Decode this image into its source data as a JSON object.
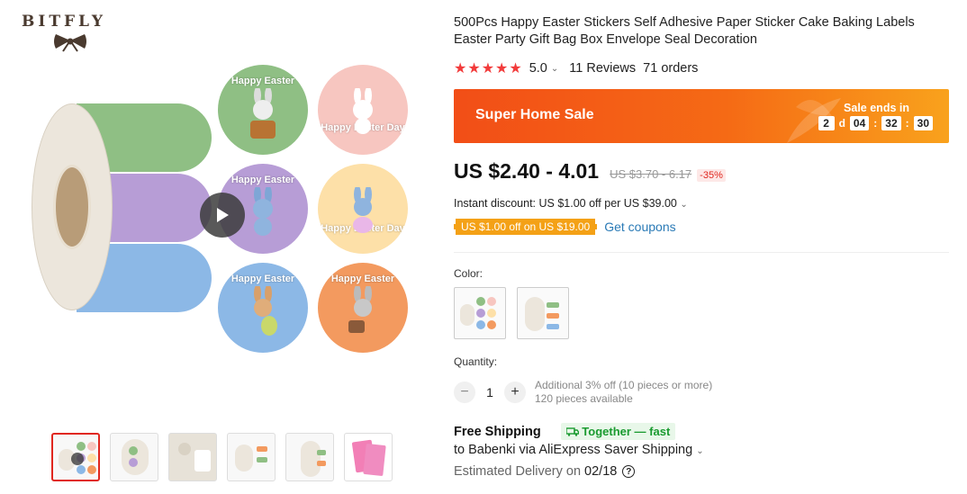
{
  "brand": {
    "name": "BITFLY",
    "logo_icon": "bow-icon"
  },
  "gallery": {
    "stickers": [
      {
        "text": "Happy Easter",
        "color": "#8fbf84"
      },
      {
        "text": "Happy Easter Day",
        "color": "#f7c6c0"
      },
      {
        "text": "Happy Easter",
        "color": "#b79dd6"
      },
      {
        "text": "Happy Easter Day",
        "color": "#fde0a8"
      },
      {
        "text": "Happy Easter",
        "color": "#8cb8e6"
      },
      {
        "text": "Happy Easter",
        "color": "#f39a5f"
      }
    ],
    "play_icon": "play-icon",
    "thumbnail_count": 6,
    "active_thumbnail": 1
  },
  "product": {
    "title": "500Pcs Happy Easter Stickers Self Adhesive Paper Sticker Cake Baking Labels Easter Party Gift Bag Box Envelope Seal Decoration",
    "rating": "5.0",
    "reviews": "11 Reviews",
    "orders": "71 orders"
  },
  "sale": {
    "name": "Super Home Sale",
    "ends_label": "Sale ends in",
    "days": "2",
    "days_unit": "d",
    "hours": "04",
    "minutes": "32",
    "seconds": "30",
    "colors": {
      "start": "#f24e17",
      "end": "#f9a21c"
    }
  },
  "pricing": {
    "price": "US $2.40 - 4.01",
    "original": "US $3.70 - 6.17",
    "discount": "-35%",
    "instant_discount": "Instant discount: US $1.00 off per US $39.00",
    "coupon_tag": "US $1.00 off on US $19.00",
    "get_coupons": "Get coupons"
  },
  "options": {
    "color_label": "Color:",
    "swatch_count": 2
  },
  "quantity": {
    "label": "Quantity:",
    "value": "1",
    "minus": "−",
    "plus": "+",
    "info_line1": "Additional 3% off (10 pieces or more)",
    "info_line2": "120 pieces available"
  },
  "shipping": {
    "free": "Free Shipping",
    "together": "Together — fast",
    "to": "to Babenki via AliExpress Saver Shipping",
    "estimated_label": "Estimated Delivery on",
    "estimated_date": "02/18",
    "help_glyph": "?"
  }
}
